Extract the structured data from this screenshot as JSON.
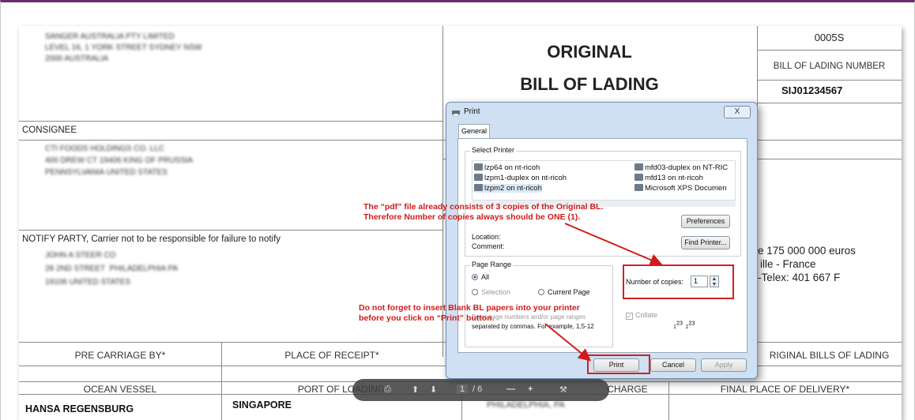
{
  "shipper_block": {
    "line1": "SANGER AUSTRALIA PTY LIMITED",
    "line2": "LEVEL 16, 1 YORK STREET SYDNEY NSW",
    "line3": "2000 AUSTRALIA"
  },
  "title": {
    "line1": "ORIGINAL",
    "line2": "BILL OF LADING"
  },
  "top_right": {
    "code": "0005S",
    "bl_number_label": "BILL OF LADING NUMBER",
    "bl_number": "SIJ01234567"
  },
  "consignee": {
    "label": "CONSIGNEE",
    "line1": "CTI FOODS HOLDINGS CO. LLC",
    "line2": "400 DREW CT 19406 KING OF PRUSSIA",
    "line3": "PENNSYLVANIA UNITED STATES"
  },
  "notify": {
    "label": "NOTIFY PARTY,  Carrier not to be responsible for failure to notify",
    "line1": "JOHN A STEER CO",
    "line2": "28 2ND STREET  PHILADELPHIA PA",
    "line3": "19106 UNITED STATES"
  },
  "carrier_info": {
    "line1": "e 175 000 000 euros",
    "line2": "ille - France",
    "line3": "-Telex: 401 667 F"
  },
  "row_headers": {
    "pre_carriage": "PRE CARRIAGE BY*",
    "place_receipt": "PLACE OF RECEIPT*",
    "original_bills": "RIGINAL BILLS OF LADING",
    "ocean_vessel": "OCEAN VESSEL",
    "port_loading": "PORT OF LOADING",
    "discharge": "CHARGE",
    "final_place": "FINAL PLACE OF DELIVERY*"
  },
  "values": {
    "vessel": "HANSA REGENSBURG",
    "port": "SINGAPORE",
    "discharge_port": "PHILADELPHIA, PA"
  },
  "dialog": {
    "title": "Print",
    "close": "X",
    "tab_general": "General",
    "select_printer": "Select Printer",
    "printers_left": [
      "lzp64 on nt-ricoh",
      "lzpm1-duplex on nt-ricoh",
      "lzpm2 on nt-ricoh"
    ],
    "printers_right": [
      "mfd03-duplex on NT-RIC",
      "mfd13 on nt-ricoh",
      "Microsoft XPS Documen"
    ],
    "preferences": "Preferences",
    "location": "Location:",
    "comment": "Comment:",
    "find_printer": "Find Printer...",
    "page_range": "Page Range",
    "all": "All",
    "selection": "Selection",
    "current_page": "Current Page",
    "pages_hint_1": "Enter page numbers and/or page ranges",
    "pages_hint_2": "separated by commas.  For example, 1,5-12",
    "copies_label": "Number of copies:",
    "copies_value": "1",
    "collate": "Collate",
    "print": "Print",
    "cancel": "Cancel",
    "apply": "Apply"
  },
  "annotations": {
    "note1_line1": "The “pdf” file already consists of 3 copies of the Original BL.",
    "note1_line2": "Therefore Number of copies always should be ONE (1).",
    "note2_line1": "Do not forget to insert Blank BL papers into your printer",
    "note2_line2": "before you click on “Print” button."
  },
  "pdf_toolbar": {
    "page": "1",
    "total": "/ 6"
  },
  "colors": {
    "accent_top": "#6b2d6b",
    "annotation": "#d11a1a",
    "dialog": "#cfe0f2"
  }
}
